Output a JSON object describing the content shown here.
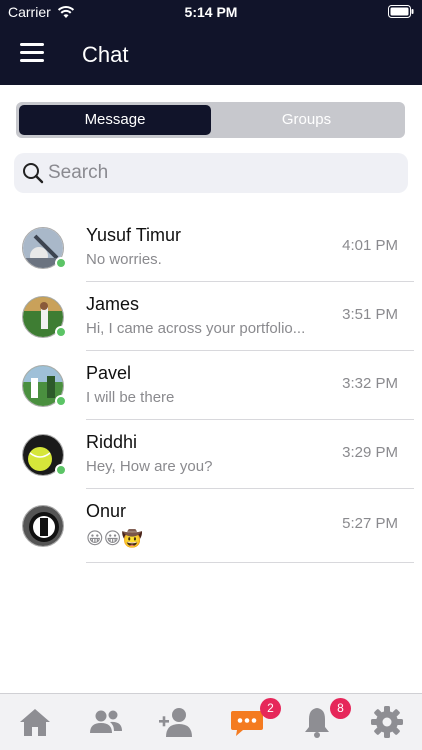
{
  "status_bar": {
    "carrier": "Carrier",
    "time": "5:14 PM"
  },
  "nav": {
    "title": "Chat"
  },
  "segments": {
    "message": "Message",
    "groups": "Groups"
  },
  "search": {
    "placeholder": "Search"
  },
  "chats": [
    {
      "name": "Yusuf Timur",
      "preview": "No worries.",
      "time": "4:01 PM",
      "online": true
    },
    {
      "name": "James",
      "preview": "Hi, I came across your portfolio...",
      "time": "3:51 PM",
      "online": true
    },
    {
      "name": "Pavel",
      "preview": "I will be there",
      "time": "3:32 PM",
      "online": true
    },
    {
      "name": "Riddhi",
      "preview": "Hey, How are you?",
      "time": "3:29 PM",
      "online": true
    },
    {
      "name": "Onur",
      "preview": "😀😀🤠",
      "time": "5:27 PM",
      "online": false
    }
  ],
  "tabs": {
    "active_color": "#f47b20",
    "inactive_color": "#8e8e93",
    "items": [
      {
        "icon": "home-icon"
      },
      {
        "icon": "people-icon"
      },
      {
        "icon": "add-user-icon"
      },
      {
        "icon": "chat-bubble-icon",
        "badge": "2",
        "active": true
      },
      {
        "icon": "bell-icon",
        "badge": "8"
      },
      {
        "icon": "gear-icon"
      }
    ]
  },
  "colors": {
    "header": "#11142a",
    "online": "#5cc466",
    "badge": "#e6275a"
  }
}
